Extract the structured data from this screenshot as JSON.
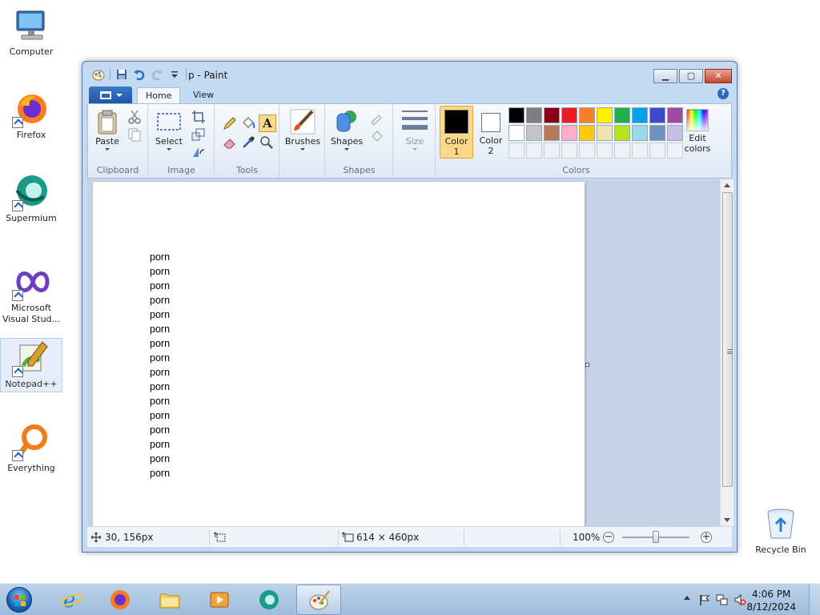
{
  "desktop": {
    "icons": [
      {
        "label": "Computer"
      },
      {
        "label": "Firefox"
      },
      {
        "label": "Supermium"
      },
      {
        "label": "Microsoft Visual Stud..."
      },
      {
        "label": "Notepad++"
      },
      {
        "label": "Everything"
      },
      {
        "label": "Recycle Bin"
      }
    ]
  },
  "window": {
    "title": "p - Paint",
    "tabs": {
      "home": "Home",
      "view": "View"
    },
    "help": "?"
  },
  "ribbon": {
    "clipboard": {
      "paste": "Paste",
      "title": "Clipboard"
    },
    "image": {
      "select": "Select",
      "title": "Image"
    },
    "tools": {
      "title": "Tools",
      "text_tool": "A"
    },
    "brushes": {
      "label": "Brushes"
    },
    "shapes": {
      "label": "Shapes",
      "title": "Shapes"
    },
    "size": {
      "label": "Size"
    },
    "colors": {
      "color1_line1": "Color",
      "color1_line2": "1",
      "color2_line1": "Color",
      "color2_line2": "2",
      "edit_line1": "Edit",
      "edit_line2": "colors",
      "title": "Colors",
      "color1_value": "#000000",
      "color2_value": "#ffffff",
      "row1": [
        "#000000",
        "#7f7f7f",
        "#880015",
        "#ed1c24",
        "#ff7f27",
        "#fff200",
        "#22b14c",
        "#00a2e8",
        "#3f48cc",
        "#a349a4"
      ],
      "row2": [
        "#ffffff",
        "#c3c3c3",
        "#b97a57",
        "#ffaec9",
        "#ffc90e",
        "#efe4b0",
        "#b5e61d",
        "#99d9ea",
        "#7092be",
        "#c8bfe7"
      ]
    }
  },
  "canvas": {
    "lines": [
      "porn",
      "porn",
      "porn",
      "porn",
      "porn",
      "porn",
      "porn",
      "porn",
      "porn",
      "porn",
      "porn",
      "porn",
      "porn",
      "porn",
      "porn",
      "porn"
    ]
  },
  "statusbar": {
    "cursor_pos": "30, 156px",
    "canvas_size": "614 × 460px",
    "zoom": "100%",
    "zoom_level": 0.5
  },
  "taskbar": {
    "time": "4:06 PM",
    "date": "8/12/2024"
  }
}
